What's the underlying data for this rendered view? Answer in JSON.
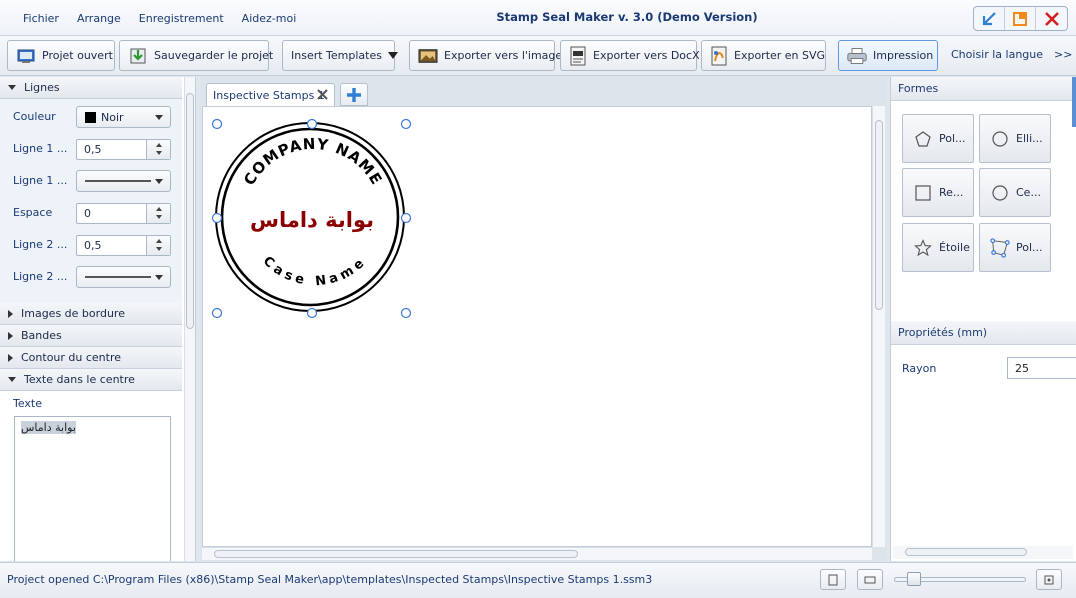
{
  "menu": [
    "Fichier",
    "Arrange",
    "Enregistrement",
    "Aidez-moi"
  ],
  "app_title": "Stamp Seal Maker v. 3.0 (Demo Version)",
  "toolbar": {
    "open_project": "Projet ouvert",
    "save_project": "Sauvegarder le projet",
    "insert_templates": "Insert Templates",
    "export_image": "Exporter vers l'image",
    "export_docx": "Exporter vers DocX",
    "export_svg": "Exporter en SVG",
    "print": "Impression",
    "choose_language": "Choisir la langue",
    "more": ">>"
  },
  "left": {
    "lines_section": "Lignes",
    "color_label": "Couleur",
    "color_value": "Noir",
    "color_hex": "#000000",
    "line1_width_label": "Ligne 1 ...",
    "line1_width_value": "0,5",
    "line1_style_label": "Ligne 1 ...",
    "spacing_label": "Espace",
    "spacing_value": "0",
    "line2_width_label": "Ligne 2 ...",
    "line2_width_value": "0,5",
    "line2_style_label": "Ligne 2 ...",
    "border_images": "Images de bordure",
    "bands": "Bandes",
    "center_outline": "Contour du centre",
    "center_text_section": "Texte dans le centre",
    "text_label": "Texte",
    "text_value": "بوابة داماس"
  },
  "document": {
    "tab_label": "Inspective Stamps 1"
  },
  "stamp": {
    "top_text": "COMPANY NAME",
    "center_text": "بوابة داماس",
    "bottom_text": "Case Name",
    "center_color": "#8b0000"
  },
  "right": {
    "shapes_title": "Formes",
    "shapes": [
      "Pol...",
      "Elli...",
      "Re...",
      "Ce...",
      "Étoile",
      "Pol..."
    ],
    "properties_title": "Propriétés (mm)",
    "radius_label": "Rayon",
    "radius_value": "25"
  },
  "status": {
    "text": "Project opened C:\\Program Files (x86)\\Stamp Seal Maker\\app\\templates\\Inspected Stamps\\Inspective Stamps 1.ssm3"
  }
}
